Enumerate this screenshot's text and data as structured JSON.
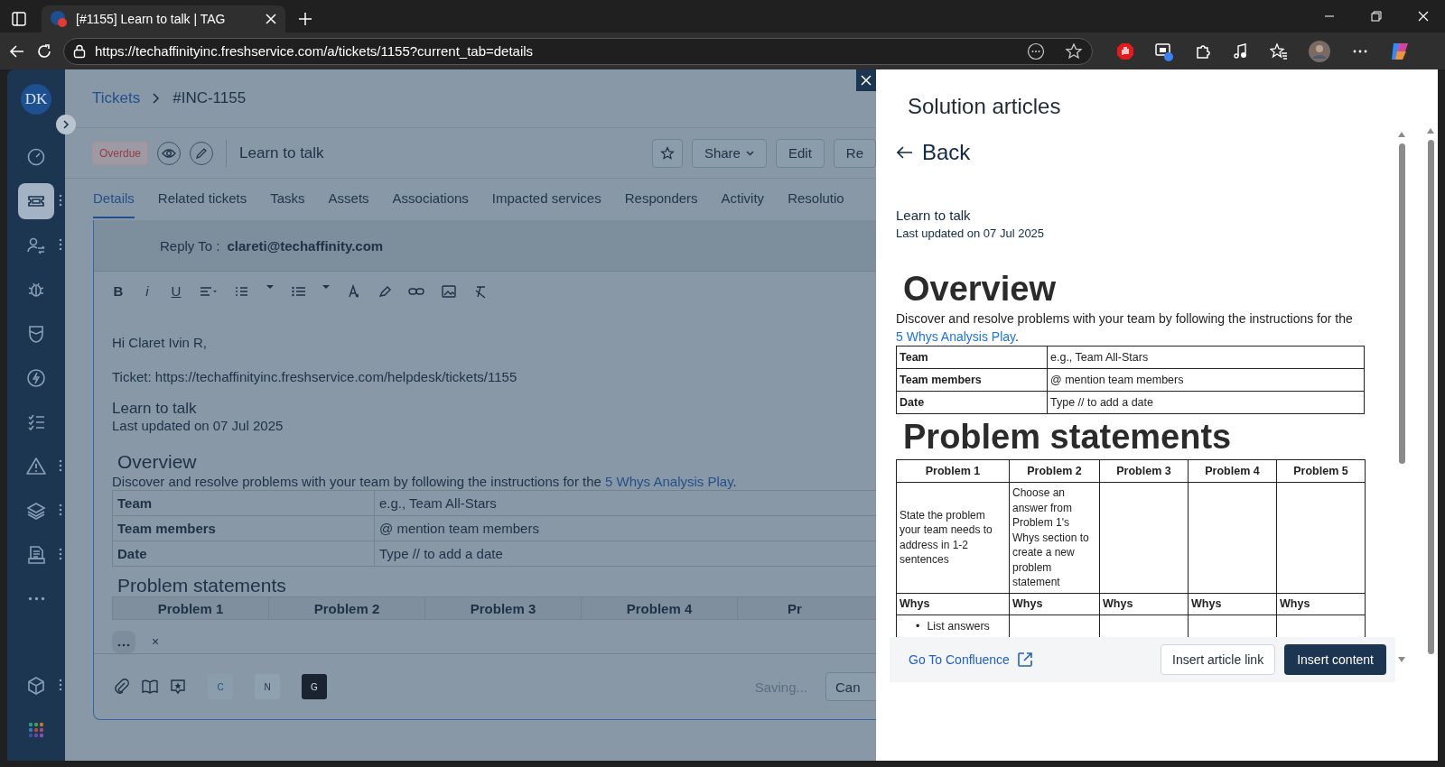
{
  "browser": {
    "tab_title": "[#1155] Learn to talk | TAG",
    "url": "https://techaffinityinc.freshservice.com/a/tickets/1155?current_tab=details"
  },
  "sidebar": {
    "avatar": "DK",
    "items": [
      {
        "kind": "gauge",
        "selected": false,
        "has_menu": false
      },
      {
        "kind": "ticket",
        "selected": true,
        "has_menu": true
      },
      {
        "kind": "people",
        "selected": false,
        "has_menu": true
      },
      {
        "kind": "bug",
        "selected": false,
        "has_menu": false
      },
      {
        "kind": "shield",
        "selected": false,
        "has_menu": false
      },
      {
        "kind": "bolt",
        "selected": false,
        "has_menu": false
      },
      {
        "kind": "checklist",
        "selected": false,
        "has_menu": false
      },
      {
        "kind": "alert",
        "selected": false,
        "has_menu": true
      },
      {
        "kind": "layers",
        "selected": false,
        "has_menu": true
      },
      {
        "kind": "document",
        "selected": false,
        "has_menu": true
      },
      {
        "kind": "more",
        "selected": false,
        "has_menu": false
      }
    ],
    "bottom_items": [
      {
        "kind": "cube",
        "selected": false,
        "has_menu": true
      },
      {
        "kind": "apps",
        "selected": false,
        "has_menu": false
      }
    ]
  },
  "breadcrumb": {
    "parent": "Tickets",
    "current": "#INC-1155"
  },
  "ticket": {
    "status": "Overdue",
    "title": "Learn to talk",
    "actions": [
      "Share",
      "Edit",
      "Re"
    ]
  },
  "tabs": [
    {
      "label": "Details",
      "selected": true
    },
    {
      "label": "Related tickets",
      "selected": false
    },
    {
      "label": "Tasks",
      "selected": false
    },
    {
      "label": "Assets",
      "selected": false
    },
    {
      "label": "Associations",
      "selected": false
    },
    {
      "label": "Impacted services",
      "selected": false
    },
    {
      "label": "Responders",
      "selected": false
    },
    {
      "label": "Activity",
      "selected": false
    },
    {
      "label": "Resolutio",
      "selected": false
    }
  ],
  "reply": {
    "reply_to_label": "Reply To :",
    "reply_to": "clareti@techaffinity.com",
    "format_buttons": [
      "B",
      "i",
      "U"
    ],
    "greeting": "Hi Claret Ivin R,",
    "ticket_line": "Ticket: https://techaffinityinc.freshservice.com/helpdesk/tickets/1155",
    "article_title": "Learn to talk",
    "updated": "Last updated on 07 Jul 2025",
    "overview_heading": "Overview",
    "intro": "Discover and resolve problems with your team by following the instructions for the ",
    "link": "5 Whys Analysis Play",
    "after": ".",
    "info_table": [
      [
        "Team",
        "e.g., Team All-Stars"
      ],
      [
        "Team members",
        "@ mention team members"
      ],
      [
        "Date",
        "Type // to add a date"
      ]
    ],
    "problem_heading": "Problem statements",
    "problem_columns": [
      "Problem 1",
      "Problem 2",
      "Problem 3",
      "Problem 4",
      "Pr"
    ],
    "dismiss": "×",
    "integrations": [
      "C",
      "N",
      "G"
    ],
    "status": "Saving...",
    "cancel": "Can"
  },
  "drawer": {
    "title": "Solution articles",
    "back": "Back",
    "article_title": "Learn to talk",
    "updated": "Last updated on 07 Jul 2025",
    "overview_heading": "Overview",
    "intro": "Discover and resolve problems with your team by following the instructions for the ",
    "link": "5 Whys Analysis Play",
    "after": ".",
    "info_table": [
      [
        "Team",
        "e.g., Team All-Stars"
      ],
      [
        "Team members",
        "@ mention team members"
      ],
      [
        "Date",
        "Type // to add a date"
      ]
    ],
    "problem_heading": "Problem statements",
    "problem_columns": [
      "Problem 1",
      "Problem 2",
      "Problem 3",
      "Problem 4",
      "Problem 5"
    ],
    "problem_row": [
      "State the problem your team needs to address in 1-2 sentences",
      "Choose an answer from Problem 1's Whys section to create a new problem statement"
    ],
    "whys_row": [
      "Whys",
      "Whys",
      "Whys",
      "Whys",
      "Whys"
    ],
    "list_marker": "•",
    "list_item": "List answers",
    "confluence_link": "Go To Confluence",
    "buttons": [
      "Insert article link",
      "Insert content"
    ]
  }
}
